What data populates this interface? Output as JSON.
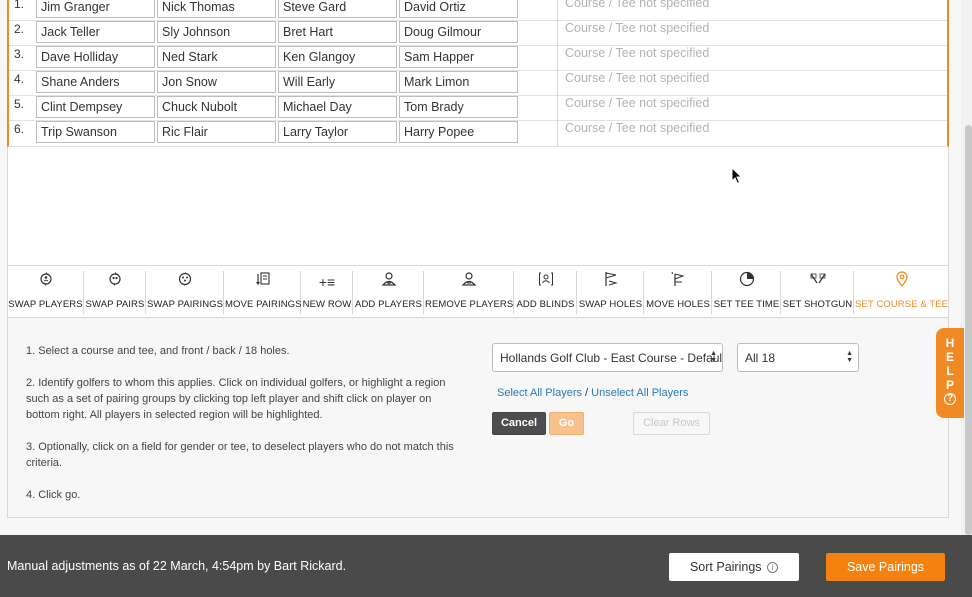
{
  "pairings": [
    {
      "num": "1.",
      "players": [
        "Jim Granger",
        "Nick Thomas",
        "Steve Gard",
        "David Ortiz"
      ],
      "course": "Course / Tee not specified"
    },
    {
      "num": "2.",
      "players": [
        "Jack Teller",
        "Sly Johnson",
        "Bret Hart",
        "Doug Gilmour"
      ],
      "course": "Course / Tee not specified"
    },
    {
      "num": "3.",
      "players": [
        "Dave Holliday",
        "Ned Stark",
        "Ken Glangoy",
        "Sam Happer"
      ],
      "course": "Course / Tee not specified"
    },
    {
      "num": "4.",
      "players": [
        "Shane Anders",
        "Jon Snow",
        "Will Early",
        "Mark Limon"
      ],
      "course": "Course / Tee not specified"
    },
    {
      "num": "5.",
      "players": [
        "Clint Dempsey",
        "Chuck Nubolt",
        "Michael Day",
        "Tom Brady"
      ],
      "course": "Course / Tee not specified"
    },
    {
      "num": "6.",
      "players": [
        "Trip Swanson",
        "Ric Flair",
        "Larry Taylor",
        "Harry Popee"
      ],
      "course": "Course / Tee not specified"
    }
  ],
  "toolbar": {
    "tools": [
      {
        "label": "SWAP PLAYERS",
        "icon": "swap-players-icon"
      },
      {
        "label": "SWAP PAIRS",
        "icon": "swap-pairs-icon"
      },
      {
        "label": "SWAP PAIRINGS",
        "icon": "swap-pairings-icon"
      },
      {
        "label": "MOVE PAIRINGS",
        "icon": "move-pairings-icon"
      },
      {
        "label": "NEW ROW",
        "icon": "new-row-icon"
      },
      {
        "label": "ADD PLAYERS",
        "icon": "add-player-icon"
      },
      {
        "label": "REMOVE PLAYERS",
        "icon": "remove-player-icon"
      },
      {
        "label": "ADD BLINDS",
        "icon": "add-blinds-icon"
      },
      {
        "label": "SWAP HOLES",
        "icon": "swap-holes-icon"
      },
      {
        "label": "MOVE HOLES",
        "icon": "move-holes-icon"
      },
      {
        "label": "SET TEE TIME",
        "icon": "tee-time-icon"
      },
      {
        "label": "SET SHOTGUN",
        "icon": "shotgun-icon"
      },
      {
        "label": "SET COURSE & TEE",
        "icon": "location-pin-icon",
        "active": true
      }
    ]
  },
  "instructions": {
    "step1": "1. Select a course and tee, and front / back / 18 holes.",
    "step2": "2. Identify golfers to whom this applies. Click on individual golfers, or highlight a region such as a set of pairing groups by clicking top left player and shift click on player on bottom right. All players in selected region will be highlighted.",
    "step3": "3. Optionally, click on a field for gender or tee, to deselect players who do not match this criteria.",
    "step4": "4. Click go."
  },
  "controls": {
    "course_select": "Hollands Golf Club - East Course - Default Tees",
    "holes_select": "All 18",
    "select_all": "Select All Players",
    "separator": "/",
    "unselect_all": "Unselect All Players",
    "cancel": "Cancel",
    "go": "Go",
    "clear_rows": "Clear Rows"
  },
  "help": {
    "letters": [
      "H",
      "E",
      "L",
      "P"
    ],
    "question": "?"
  },
  "footer": {
    "status": "Manual adjustments as of 22 March, 4:54pm by Bart Rickard.",
    "sort_label": "Sort Pairings",
    "info_icon": "i",
    "save_label": "Save Pairings"
  },
  "colors": {
    "accent": "#f08a24",
    "footer_bg": "#4a4a4a",
    "link": "#2a7ab8"
  }
}
